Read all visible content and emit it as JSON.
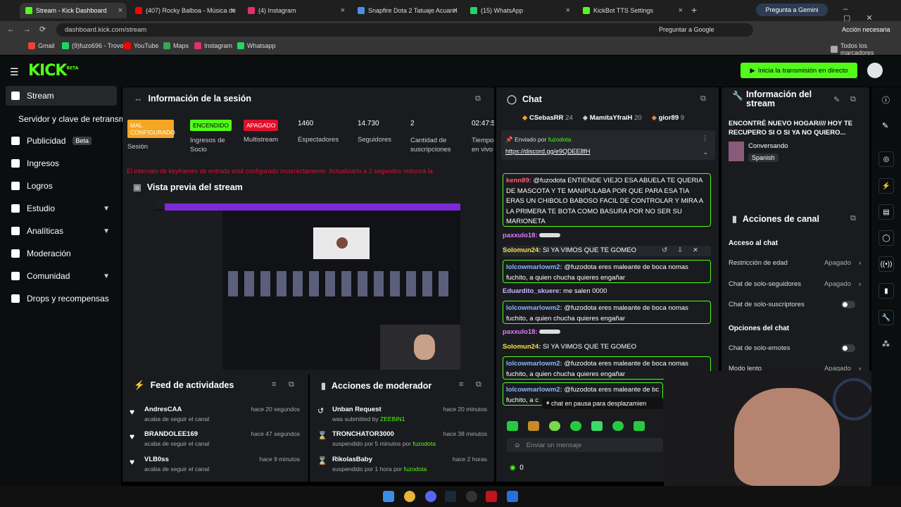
{
  "browser": {
    "tabs": [
      {
        "label": "Stream - Kick Dashboard",
        "color": "#53fc18"
      },
      {
        "label": "(407) Rocky Balboa - Música de",
        "color": "#ff0000"
      },
      {
        "label": "(4) Instagram",
        "color": "#e1306c"
      },
      {
        "label": "Snapfire Dota 2 Tatuaje Acuarel",
        "color": "#4a90e2"
      },
      {
        "label": "(15) WhatsApp",
        "color": "#25d366"
      },
      {
        "label": "KickBot TTS Settings",
        "color": "#53fc18"
      }
    ],
    "gemini": "Pregunta a Gemini",
    "url": "dashboard.kick.com/stream",
    "ask_google": "Preguntar a Google",
    "action_needed": "Acción necesaria",
    "bookmarks": [
      "Gmail",
      "(9)fuzo696 - Trovo",
      "YouTube",
      "Maps",
      "Instagram",
      "Whatsapp"
    ],
    "all_bookmarks": "Todos los marcadores"
  },
  "kick": {
    "logo": "KICK",
    "beta": "BETA",
    "go_live": "Inicia la transmisión en directo"
  },
  "sidebar": {
    "items": [
      {
        "label": "Stream"
      },
      {
        "label": "Servidor y clave de retransmisión"
      },
      {
        "label": "Publicidad",
        "badge": "Beta"
      },
      {
        "label": "Ingresos"
      },
      {
        "label": "Logros"
      },
      {
        "label": "Estudio"
      },
      {
        "label": "Analíticas"
      },
      {
        "label": "Moderación"
      },
      {
        "label": "Comunidad"
      },
      {
        "label": "Drops y recompensas"
      }
    ]
  },
  "session": {
    "title": "Información de la sesión",
    "stats": [
      {
        "value": "MAL CONFIGURADO",
        "label": "Sesión",
        "color": "#f5a623"
      },
      {
        "value": "ENCENDIDO",
        "label": "Ingresos de Socio",
        "color": "#53fc18"
      },
      {
        "value": "APAGADO",
        "label": "Multistream",
        "color": "#e0102a"
      },
      {
        "value": "1460",
        "label": "Espectadores"
      },
      {
        "value": "14.730",
        "label": "Seguidores"
      },
      {
        "value": "2",
        "label": "Cantidad de suscripciones"
      },
      {
        "value": "02:47:5",
        "label": "Tiempo en vivo"
      }
    ],
    "warning": "El intervalo de keyframes de entrada está configurado incorrectamente. Actualizarlo a 2 segundos reducirá la"
  },
  "preview": {
    "title": "Vista previa del stream"
  },
  "feed": {
    "title": "Feed de actividades",
    "items": [
      {
        "name": "AndresCAA",
        "sub": "acaba de seguir el canal",
        "time": "hace 20 segundos"
      },
      {
        "name": "BRANDOLEE169",
        "sub": "acaba de seguir el canal",
        "time": "hace 47 segundos"
      },
      {
        "name": "VLB0ss",
        "sub": "acaba de seguir el canal",
        "time": "hace 9 minutos"
      }
    ]
  },
  "modactions": {
    "title": "Acciones de moderador",
    "items": [
      {
        "name": "Unban Request",
        "sub": "was submitted by",
        "who": "ZEEBIN1",
        "time": "hace 20 minutos"
      },
      {
        "name": "TRONCHATOR3000",
        "sub": "suspendido por 5 minutos por",
        "who": "fuzodota",
        "time": "hace 38 minutos"
      },
      {
        "name": "RikolasBaby",
        "sub": "suspendido por 1 hora por",
        "who": "fuzodota",
        "time": "hace 2 horas"
      }
    ]
  },
  "chat": {
    "title": "Chat",
    "leaders": [
      {
        "name": "CSebasRR",
        "n": "24"
      },
      {
        "name": "MamitaYfraiH",
        "n": "20"
      },
      {
        "name": "gior89",
        "n": "9"
      }
    ],
    "pinned_by": "Enviado por",
    "pinned_user": "fuzodota",
    "pinned_link": "https://discord.gg/e9QDEE8fH",
    "messages": [
      {
        "user": "kenn89:",
        "text": "@fuzodota ENTIENDE VIEJO ESA ABUELA TE QUERIA DE MASCOTA Y TE MANIPULABA POR QUE PARA ESA TIA ERAS UN CHIBOLO BABOSO FACIL DE CONTROLAR Y MIRA A LA PRIMERA TE BOTA COMO BASURA POR NO SER SU MARIONETA"
      },
      {
        "user": "paxxulo18:",
        "text": ""
      },
      {
        "user": "Solomun24:",
        "text": "SI YA VIMOS QUE TE GOMEO"
      },
      {
        "user": "lolcowmarlowm2:",
        "text": "@fuzodota eres maleante de boca nomas fuchito, a quien chucha quieres engañar"
      },
      {
        "user": "Eduardito_skuere:",
        "text": "me salen 0000"
      },
      {
        "user": "lolcowmarlowm2:",
        "text": "@fuzodota eres maleante de boca nomas fuchito, a quien chucha quieres engañar"
      },
      {
        "user": "paxxulo18:",
        "text": ""
      },
      {
        "user": "Solomun24:",
        "text": "SI YA VIMOS QUE TE GOMEO"
      },
      {
        "user": "lolcowmarlowm2:",
        "text": "@fuzodota eres maleante de boca nomas fuchito, a quien chucha quieres engañar"
      },
      {
        "user": "lolcowmarlowm2:",
        "text": "@fuzodota eres maleante de bc fuchito, a c"
      }
    ],
    "paused": "chat en pausa para desplazamien",
    "placeholder": "Enviar un mensaje",
    "balance": "0"
  },
  "streaminfo": {
    "title": "Información del stream",
    "stream_title": "ENCONTRÉ NUEVO HOGAR//// HOY TE RECUPERO SI O SI YA NO QUIERO...",
    "category": "Conversando",
    "language": "Spanish"
  },
  "channel": {
    "title": "Acciones de canal",
    "access": "Acceso al chat",
    "rows": [
      {
        "label": "Restricción de edad",
        "value": "Apagado"
      },
      {
        "label": "Chat de solo-seguidores",
        "value": "Apagado"
      },
      {
        "label": "Chat de solo-suscriptores",
        "value": ""
      }
    ],
    "options": "Opciones del chat",
    "rows2": [
      {
        "label": "Chat de solo-emotes",
        "value": ""
      },
      {
        "label": "Modo lento",
        "value": "Apagado"
      }
    ]
  }
}
